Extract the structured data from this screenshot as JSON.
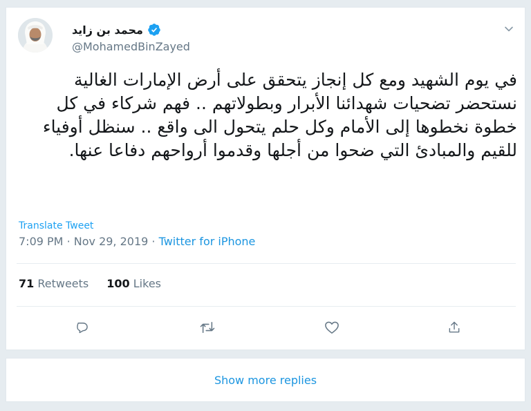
{
  "author": {
    "display_name": "محمد بن زايد",
    "handle": "@MohamedBinZayed",
    "verified": true
  },
  "tweet": {
    "text": "في يوم الشهيد ومع كل إنجاز يتحقق على أرض الإمارات الغالية نستحضر تضحيات شهدائنا الأبرار وبطولاتهم .. فهم شركاء في كل خطوة نخطوها إلى الأمام وكل حلم يتحول الى واقع .. سنظل أوفياء للقيم والمبادئ التي ضحوا من أجلها وقدموا أرواحهم دفاعا عنها.",
    "translate_label": "Translate Tweet",
    "time": "7:09 PM",
    "date": "Nov 29, 2019",
    "separator": "·",
    "source": "Twitter for iPhone"
  },
  "stats": {
    "retweets_count": "71",
    "retweets_label": "Retweets",
    "likes_count": "100",
    "likes_label": "Likes"
  },
  "actions": [
    "reply-icon",
    "retweet-icon",
    "like-icon",
    "share-icon"
  ],
  "show_more_replies": "Show more replies",
  "colors": {
    "accent": "#1da1f2",
    "link": "#1b95e0",
    "muted": "#657786",
    "background": "#e6ecf0"
  }
}
